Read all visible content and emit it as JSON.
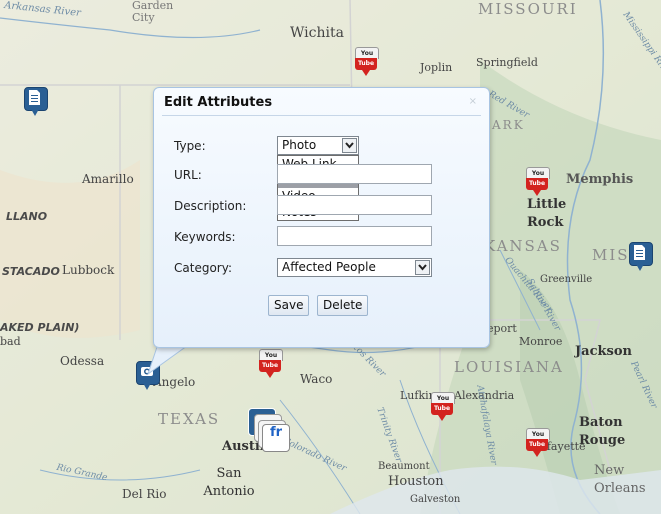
{
  "map": {
    "labels": {
      "missouri": "MISSOURI",
      "arkansas": "ARK",
      "arkansas2": "KANSAS",
      "louisiana": "LOUISIANA",
      "texas": "TEXAS",
      "mississippi": "MIS",
      "llano": "LLANO",
      "estacado": "STACADO",
      "staked_plain": "AKED PLAIN)",
      "arkansas_river": "Arkansas River",
      "garden_city": "Garden City",
      "wichita": "Wichita",
      "joplin": "Joplin",
      "springfield": "Springfield",
      "amarillo": "Amarillo",
      "lubbock": "Lubbock",
      "odessa": "Odessa",
      "angelo": "Angelo",
      "waco": "Waco",
      "austin": "Austin",
      "san_antonio": "San Antonio",
      "del_rio": "Del Rio",
      "rio_grande": "Rio Grande",
      "houston": "Houston",
      "beaumont": "Beaumont",
      "galveston": "Galveston",
      "lufkin": "Lufkin",
      "alexandria": "Alexandria",
      "lafayette": "Lafayette",
      "baton_rouge": "Baton Rouge",
      "new_orleans": "New Orleans",
      "jackson": "Jackson",
      "monroe": "Monroe",
      "greenville": "Greenville",
      "memphis": "Memphis",
      "little_rock": "Little Rock",
      "shreveport": "eport",
      "bad": "bad",
      "mississippi_river": "Mississippi River",
      "ouachita_river": "Ouachita River",
      "red_river": "Red River",
      "pearl_river": "Pearl River",
      "brazos_river": "Brazos River",
      "trinity_river": "Trinity River",
      "colorado_river": "Colorado River",
      "sabine_river": "Sabine River",
      "atchafalaya_river": "Atchafalaya River"
    },
    "youtube_head": "You",
    "youtube_body": "Tube",
    "flickr_badge": "fr"
  },
  "dialog": {
    "title": "Edit Attributes",
    "close": "×",
    "type_label": "Type:",
    "type_value": "Photo",
    "type_options": [
      "Web Link",
      "Photo",
      "Video",
      "Notes"
    ],
    "type_highlighted": "Photo",
    "url_label": "URL:",
    "url_value": "",
    "description_label": "Description:",
    "description_value": "",
    "keywords_label": "Keywords:",
    "keywords_value": "",
    "category_label": "Category:",
    "category_value": "Affected People",
    "save": "Save",
    "delete": "Delete"
  }
}
